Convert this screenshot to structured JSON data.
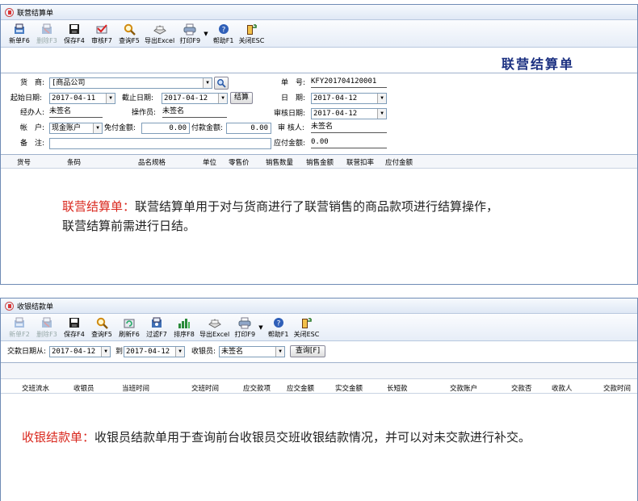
{
  "win1": {
    "title": "联营结算单",
    "toolbar": [
      {
        "label": "新单F6",
        "icon": "new-doc-icon",
        "disabled": false
      },
      {
        "label": "删除F3",
        "icon": "delete-doc-icon",
        "disabled": true
      },
      {
        "label": "保存F4",
        "icon": "save-icon",
        "disabled": false
      },
      {
        "label": "审核F7",
        "icon": "approve-icon",
        "disabled": false
      },
      {
        "label": "查询F5",
        "icon": "search-icon",
        "disabled": false
      },
      {
        "label": "导出Excel",
        "icon": "export-excel-icon",
        "disabled": false
      },
      {
        "label": "打印F9",
        "icon": "printer-icon",
        "disabled": false
      },
      {
        "label": "帮助F1",
        "icon": "help-icon",
        "disabled": false
      },
      {
        "label": "关闭ESC",
        "icon": "exit-icon",
        "disabled": false
      }
    ],
    "heading": "联营结算单",
    "form": {
      "supplier_label": "货　商:",
      "supplier_value": "[商品公司",
      "start_label": "起始日期:",
      "start_value": "2017-04-11",
      "end_label": "截止日期:",
      "end_value": "2017-04-12",
      "settle_btn": "结算",
      "handler_label": "经办人:",
      "handler_value": "未签名",
      "operator_label": "操作员:",
      "operator_value": "未签名",
      "account_label": "帐　户:",
      "account_value": "现金账户",
      "free_label": "免付金额:",
      "free_value": "0.00",
      "pay_label": "付款金额:",
      "pay_value": "0.00",
      "remark_label": "备　注:",
      "remark_value": "",
      "docno_label": "单　号:",
      "docno_value": "KFY201704120001",
      "date_label": "日　期:",
      "date_value": "2017-04-12",
      "audit_date_label": "审核日期:",
      "audit_date_value": "2017-04-12",
      "auditor_label": "审 核人:",
      "auditor_value": "未签名",
      "payable_label": "应付金额:",
      "payable_value": "0.00"
    },
    "columns": [
      "货号",
      "条码",
      "品名规格",
      "单位",
      "零售价",
      "销售数量",
      "销售金额",
      "联营扣率",
      "应付金额"
    ],
    "desc_title": "联营结算单：",
    "desc_line1": "联营结算单用于对与货商进行了联营销售的商品款项进行结算操作，",
    "desc_line2": "联营结算前需进行日结。"
  },
  "win2": {
    "title": "收银结款单",
    "toolbar": [
      {
        "label": "新单F2",
        "icon": "new-doc-icon",
        "disabled": true
      },
      {
        "label": "删除F3",
        "icon": "delete-doc-icon",
        "disabled": true
      },
      {
        "label": "保存F4",
        "icon": "save-icon",
        "disabled": false
      },
      {
        "label": "查询F5",
        "icon": "search-icon",
        "disabled": false
      },
      {
        "label": "刷新F6",
        "icon": "refresh-icon",
        "disabled": false
      },
      {
        "label": "过滤F7",
        "icon": "filter-icon",
        "disabled": false
      },
      {
        "label": "排序F8",
        "icon": "sort-icon",
        "disabled": false
      },
      {
        "label": "导出Excel",
        "icon": "export-excel-icon",
        "disabled": false
      },
      {
        "label": "打印F9",
        "icon": "printer-icon",
        "disabled": false
      },
      {
        "label": "帮助F1",
        "icon": "help-icon",
        "disabled": false
      },
      {
        "label": "关闭ESC",
        "icon": "exit-icon",
        "disabled": false
      }
    ],
    "filter": {
      "date_from_label": "交款日期从:",
      "date_from_value": "2017-04-12",
      "to_label": "到",
      "date_to_value": "2017-04-12",
      "cashier_label": "收银员:",
      "cashier_value": "未签名",
      "query_btn": "查询[F]"
    },
    "columns": [
      "交班流水",
      "收银员",
      "当班时间",
      "交班时间",
      "应交款项",
      "应交金额",
      "实交金额",
      "长短款",
      "交款账户",
      "交款否",
      "收款人",
      "交款时间"
    ],
    "desc_title": "收银结款单：",
    "desc_line1": "收银员结款单用于查询前台收银员交班收银结款情况，并可以对未交款进行补交。"
  },
  "colors": {
    "accent_red": "#d9281e",
    "heading_blue": "#1a2f80",
    "border_blue": "#6f8bb5"
  }
}
